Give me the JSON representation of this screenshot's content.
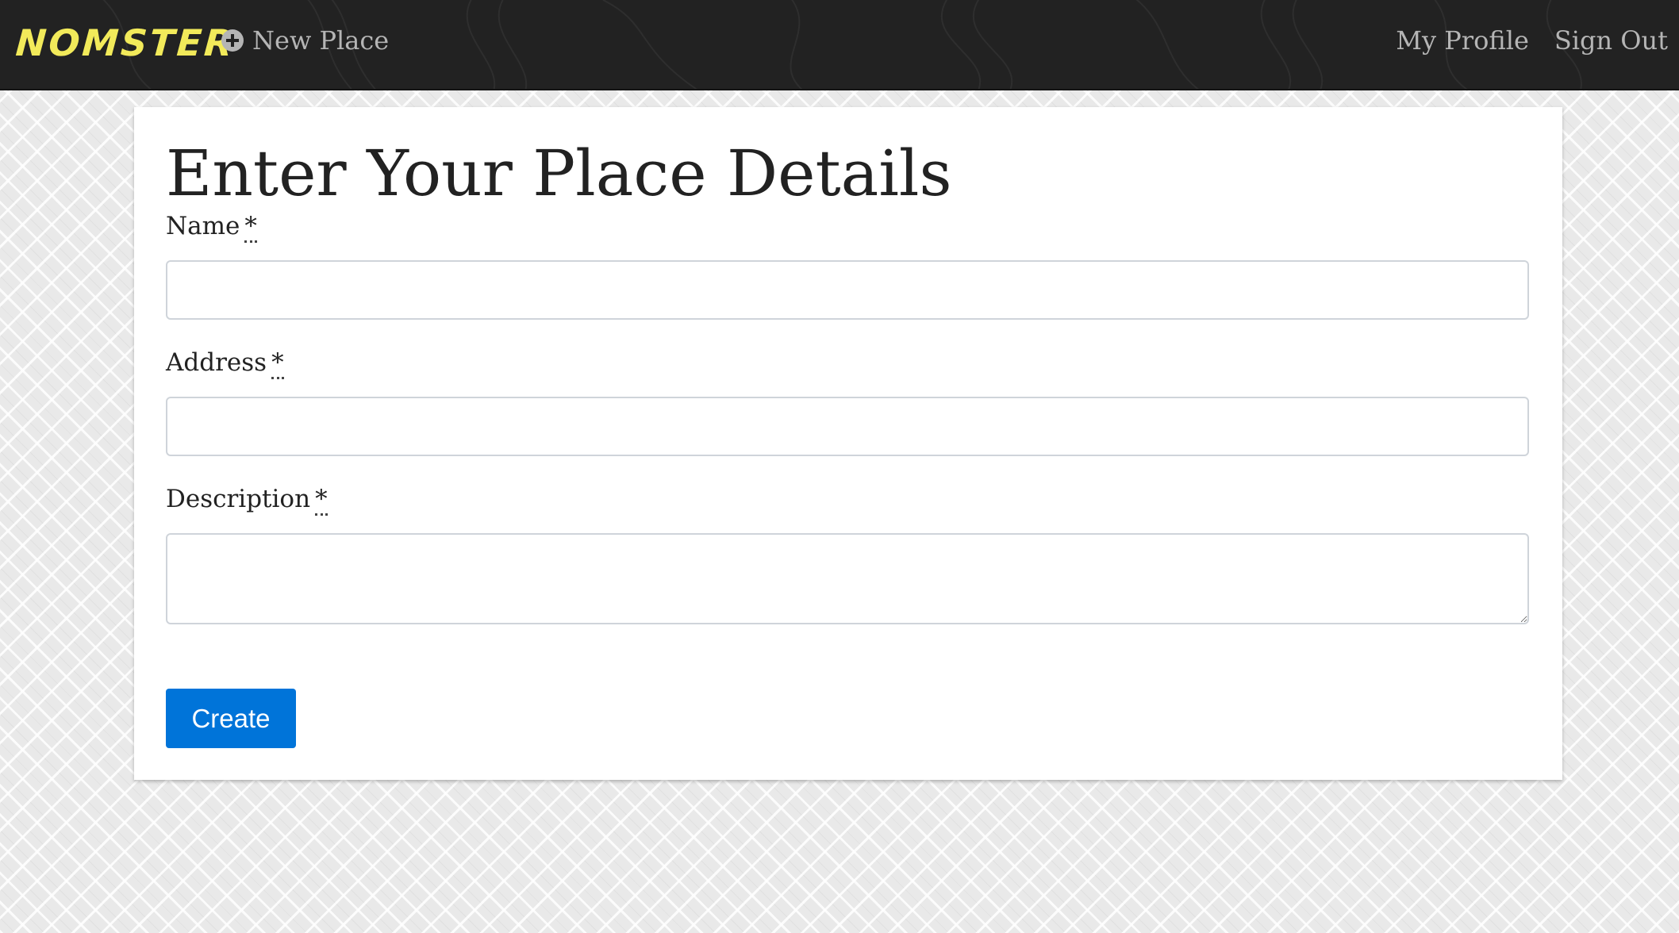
{
  "navbar": {
    "brand": "NOMSTER",
    "new_place_label": "New Place",
    "new_place_icon": "plus-circle-icon",
    "my_profile_label": "My Profile",
    "sign_out_label": "Sign Out",
    "brand_color": "#f2ea5a",
    "background_color": "#222222",
    "link_color": "#b5b5b5"
  },
  "form": {
    "title": "Enter Your Place Details",
    "required_marker": "*",
    "name_label": "Name",
    "name_value": "",
    "address_label": "Address",
    "address_value": "",
    "description_label": "Description",
    "description_value": "",
    "submit_label": "Create",
    "submit_color": "#0074d9"
  }
}
